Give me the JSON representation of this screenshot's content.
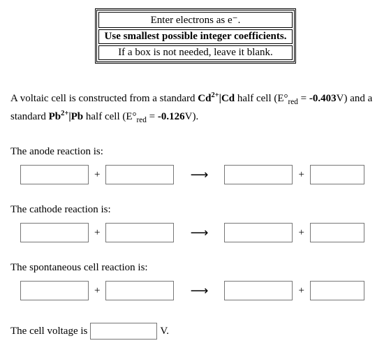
{
  "instructions": {
    "line1": "Enter electrons as e⁻.",
    "line2": "Use smallest possible integer coefficients.",
    "line3": "If a box is not needed, leave it blank."
  },
  "prompt": {
    "part1": "A voltaic cell is constructed from a standard ",
    "couple1_html": "Cd<sup>2+</sup>|Cd",
    "part2": " half cell (E°",
    "sub_red": "red",
    "eq1": " = ",
    "val1": "-0.403",
    "unit": "V) and a standard ",
    "couple2_html": "Pb<sup>2+</sup>|Pb",
    "part3": " half cell (E°",
    "eq2": " = ",
    "val2": "-0.126",
    "close": "V)."
  },
  "labels": {
    "anode": "The anode reaction is:",
    "cathode": "The cathode reaction is:",
    "spont": "The spontaneous cell reaction is:",
    "voltage_pre": "The cell voltage is",
    "voltage_unit": "V."
  },
  "symbols": {
    "plus": "+",
    "arrow": "⟶"
  }
}
